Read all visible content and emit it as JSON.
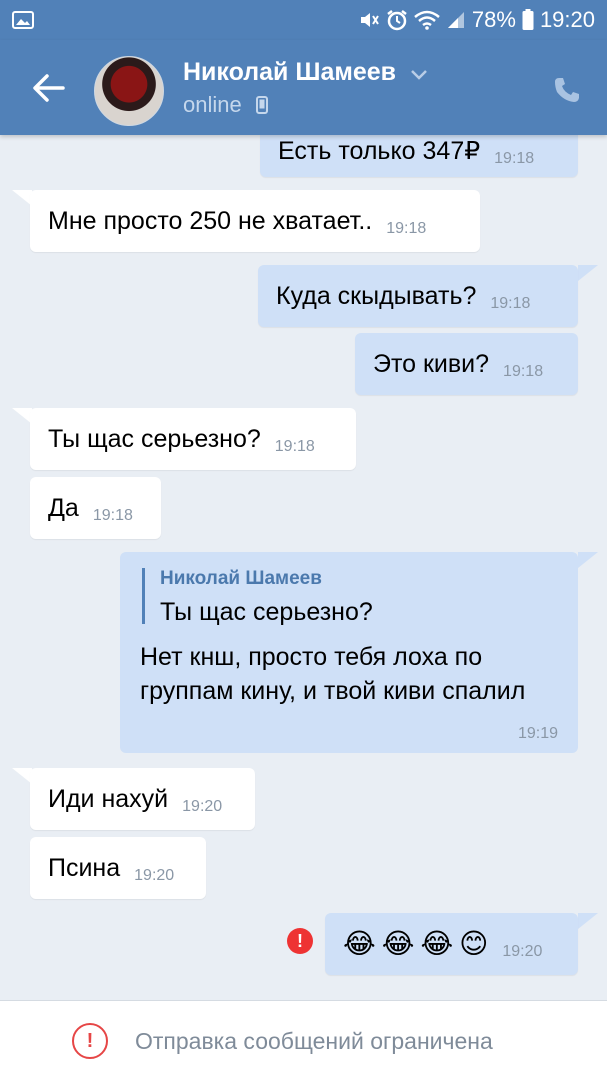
{
  "status_bar": {
    "battery": "78%",
    "time": "19:20",
    "icons": [
      "image-notification-icon",
      "mute-icon",
      "alarm-icon",
      "wifi-icon",
      "signal-icon",
      "battery-icon"
    ]
  },
  "header": {
    "contact_name": "Николай Шамеев",
    "status": "online",
    "icons": [
      "back-arrow-icon",
      "chevron-down-icon",
      "mobile-phone-icon",
      "phone-call-icon"
    ]
  },
  "colors": {
    "header": "#5181b8",
    "incoming_bubble": "#ffffff",
    "outgoing_bubble": "#cfe0f7",
    "chat_bg": "#e9eef4",
    "error": "#e64646"
  },
  "messages": [
    {
      "dir": "out",
      "text": "Есть только 347₽",
      "time": "19:18"
    },
    {
      "dir": "in",
      "text": "Мне просто 250 не хватает..",
      "time": "19:18"
    },
    {
      "dir": "out",
      "text": "Куда скыдывать?",
      "time": "19:18"
    },
    {
      "dir": "out",
      "text": "Это киви?",
      "time": "19:18"
    },
    {
      "dir": "in",
      "text": "Ты щас серьезно?",
      "time": "19:18"
    },
    {
      "dir": "in",
      "text": "Да",
      "time": "19:18"
    },
    {
      "dir": "out",
      "reply_to": {
        "author": "Николай Шамеев",
        "text": "Ты щас серьезно?"
      },
      "text": "Нет кнш, просто тебя лоха по группам кину, и твой киви спалил",
      "time": "19:19"
    },
    {
      "dir": "in",
      "text": "Иди нахуй",
      "time": "19:20"
    },
    {
      "dir": "in",
      "text": "Псина",
      "time": "19:20"
    },
    {
      "dir": "out",
      "emojis": [
        "😂",
        "😂",
        "😂",
        "😊"
      ],
      "time": "19:20",
      "failed": true
    }
  ],
  "bottom_bar": {
    "restriction_text": "Отправка сообщений ограничена",
    "icon": "exclamation-circle-icon"
  }
}
